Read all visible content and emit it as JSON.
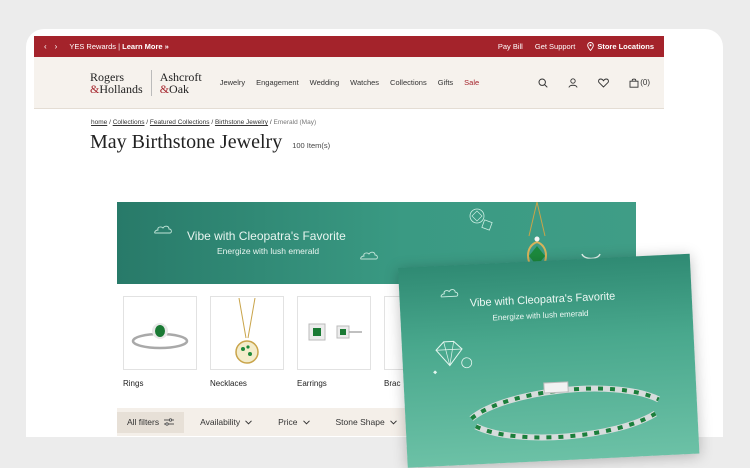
{
  "topbar": {
    "promo_prefix": "YES Rewards |",
    "promo_link": "Learn More »",
    "pay_bill": "Pay Bill",
    "support": "Get Support",
    "stores": "Store Locations",
    "prev_arrow": "‹",
    "next_arrow": "›"
  },
  "logo": {
    "rh_line1": "Rogers",
    "rh_amp": "&",
    "rh_line2": "Hollands",
    "ao_line1": "Ashcroft",
    "ao_amp": "&",
    "ao_line2": "Oak"
  },
  "nav": [
    "Jewelry",
    "Engagement",
    "Wedding",
    "Watches",
    "Collections",
    "Gifts",
    "Sale"
  ],
  "cart": {
    "count": "(0)"
  },
  "breadcrumb": {
    "items": [
      "home",
      "Collections",
      "Featured Collections",
      "Birthstone Jewelry"
    ],
    "separator": " / ",
    "current": "Emerald (May)"
  },
  "page": {
    "title": "May Birthstone Jewelry",
    "count": "100 Item(s)"
  },
  "banner": {
    "title": "Vibe with Cleopatra's Favorite",
    "subtitle": "Energize with lush emerald"
  },
  "categories": [
    {
      "label": "Rings"
    },
    {
      "label": "Necklaces"
    },
    {
      "label": "Earrings"
    },
    {
      "label": "Brac"
    }
  ],
  "filters": {
    "all": "All filters",
    "items": [
      "Availability",
      "Price",
      "Stone Shape"
    ]
  },
  "overlay": {
    "title": "Vibe with Cleopatra's Favorite",
    "subtitle": "Energize with lush emerald"
  },
  "colors": {
    "brand_red": "#a4232b",
    "emerald": "#2f8a73",
    "header_bg": "#f6f2ed"
  }
}
